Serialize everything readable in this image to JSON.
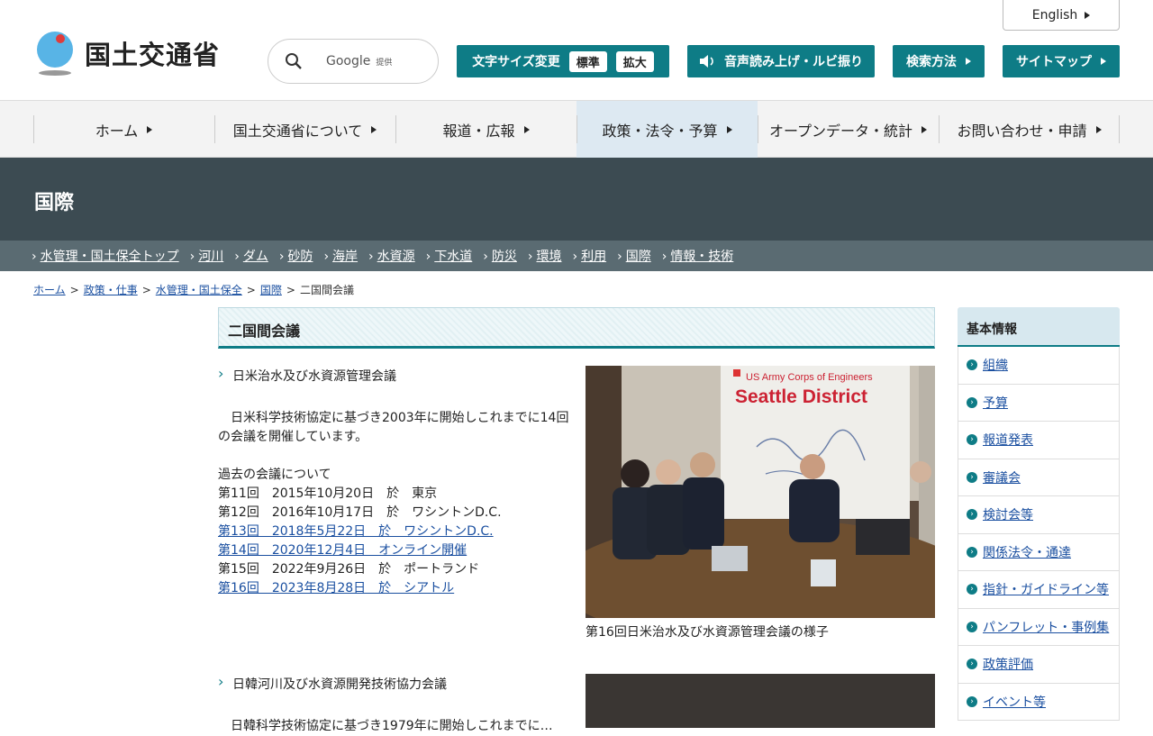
{
  "header": {
    "logo_text": "国土交通省",
    "search": {
      "provider": "Google",
      "provider_sub": "提供"
    },
    "english_label": "English",
    "font_size": {
      "label": "文字サイズ変更",
      "standard": "標準",
      "large": "拡大"
    },
    "voice_label": "音声読み上げ・ルビ振り",
    "howto_label": "検索方法",
    "sitemap_label": "サイトマップ"
  },
  "gnav": [
    {
      "label": "ホーム"
    },
    {
      "label": "国土交通省について"
    },
    {
      "label": "報道・広報"
    },
    {
      "label": "政策・法令・予算"
    },
    {
      "label": "オープンデータ・統計"
    },
    {
      "label": "お問い合わせ・申請"
    }
  ],
  "category": {
    "title": "国際",
    "links": [
      "水管理・国土保全トップ",
      "河川",
      "ダム",
      "砂防",
      "海岸",
      "水資源",
      "下水道",
      "防災",
      "環境",
      "利用",
      "国際",
      "情報・技術"
    ]
  },
  "breadcrumb": {
    "items": [
      "ホーム",
      "政策・仕事",
      "水管理・国土保全",
      "国際"
    ],
    "current": "二国間会議",
    "sep": ">"
  },
  "main": {
    "heading": "二国間会議",
    "sections": [
      {
        "title": "日米治水及び水資源管理会議",
        "intro": "　日米科学技術協定に基づき2003年に開始しこれまでに14回の会議を開催しています。",
        "past_label": "過去の会議について",
        "meetings": [
          {
            "text": "第11回　2015年10月20日　於　東京",
            "link": false
          },
          {
            "text": "第12回　2016年10月17日　於　ワシントンD.C.",
            "link": false
          },
          {
            "text": "第13回　2018年5月22日　於　ワシントンD.C.",
            "link": true
          },
          {
            "text": "第14回　2020年12月4日　オンライン開催",
            "link": true
          },
          {
            "text": "第15回　2022年9月26日　於　ポートランド",
            "link": false
          },
          {
            "text": "第16回　2023年8月28日　於　シアトル",
            "link": true
          }
        ],
        "photo_sign_top": "US Army Corps of Engineers",
        "photo_sign_main": "Seattle District",
        "caption": "第16回日米治水及び水資源管理会議の様子"
      },
      {
        "title": "日韓河川及び水資源開発技術協力会議",
        "intro": "　日韓科学技術協定に基づき1979年に開始しこれまでに…"
      }
    ]
  },
  "sidebar": {
    "heading": "基本情報",
    "items": [
      "組織",
      "予算",
      "報道発表",
      "審議会",
      "検討会等",
      "関係法令・通達",
      "指針・ガイドライン等",
      "パンフレット・事例集",
      "政策評価",
      "イベント等"
    ]
  },
  "colors": {
    "primary": "#0e7c86",
    "band": "#3c4b52",
    "link": "#1a4fa0"
  }
}
